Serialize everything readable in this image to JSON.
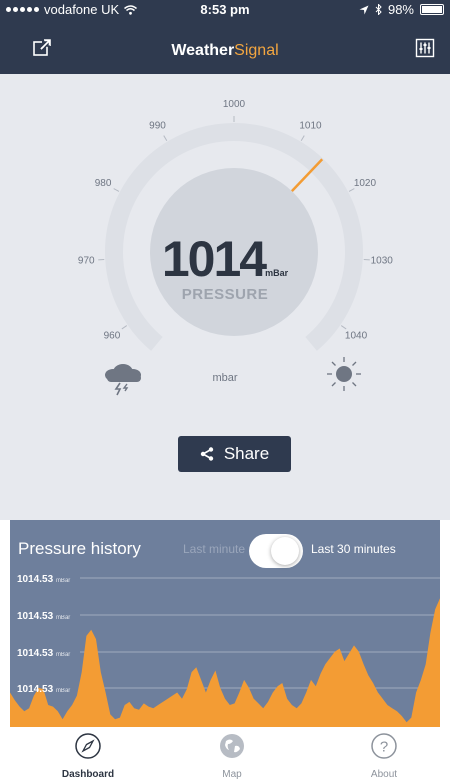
{
  "status": {
    "carrier": "vodafone UK",
    "time": "8:53 pm",
    "battery": "98%"
  },
  "nav": {
    "title_part1": "Weather",
    "title_part2": "Signal"
  },
  "gauge": {
    "value": "1014",
    "unit": "mBar",
    "label": "PRESSURE",
    "caption": "mbar",
    "ticks": [
      "960",
      "970",
      "980",
      "990",
      "1000",
      "1010",
      "1020",
      "1030",
      "1040"
    ],
    "needle_value": 1014,
    "min": 955,
    "max": 1045
  },
  "share": {
    "label": "Share"
  },
  "history": {
    "title": "Pressure history",
    "option_left": "Last minute",
    "option_right": "Last 30 minutes",
    "selected": "Last 30 minutes",
    "y_labels": [
      "1014.53",
      "1014.53",
      "1014.53",
      "1014.53"
    ],
    "y_unit": "mBar",
    "series": [
      0.22,
      0.17,
      0.13,
      0.1,
      0.12,
      0.2,
      0.25,
      0.24,
      0.14,
      0.13,
      0.1,
      0.05,
      0.1,
      0.14,
      0.2,
      0.35,
      0.58,
      0.62,
      0.56,
      0.35,
      0.22,
      0.08,
      0.05,
      0.06,
      0.14,
      0.16,
      0.12,
      0.11,
      0.15,
      0.13,
      0.12,
      0.14,
      0.16,
      0.18,
      0.2,
      0.22,
      0.18,
      0.24,
      0.35,
      0.38,
      0.3,
      0.22,
      0.3,
      0.36,
      0.25,
      0.18,
      0.14,
      0.15,
      0.22,
      0.3,
      0.25,
      0.18,
      0.15,
      0.12,
      0.16,
      0.22,
      0.26,
      0.28,
      0.18,
      0.14,
      0.12,
      0.15,
      0.22,
      0.3,
      0.26,
      0.34,
      0.4,
      0.44,
      0.48,
      0.5,
      0.42,
      0.47,
      0.52,
      0.48,
      0.4,
      0.33,
      0.28,
      0.22,
      0.18,
      0.14,
      0.12,
      0.1,
      0.07,
      0.03,
      0.06,
      0.22,
      0.3,
      0.4,
      0.6,
      0.75,
      0.82
    ]
  },
  "tabs": [
    {
      "label": "Dashboard",
      "icon": "compass-icon",
      "active": true
    },
    {
      "label": "Map",
      "icon": "globe-icon",
      "active": false
    },
    {
      "label": "About",
      "icon": "question-icon",
      "active": false
    }
  ],
  "colors": {
    "accent": "#f39c34",
    "navy": "#2f3a4f",
    "history_bg": "#6e7f9c",
    "gauge_bg": "#e7e9ee"
  }
}
